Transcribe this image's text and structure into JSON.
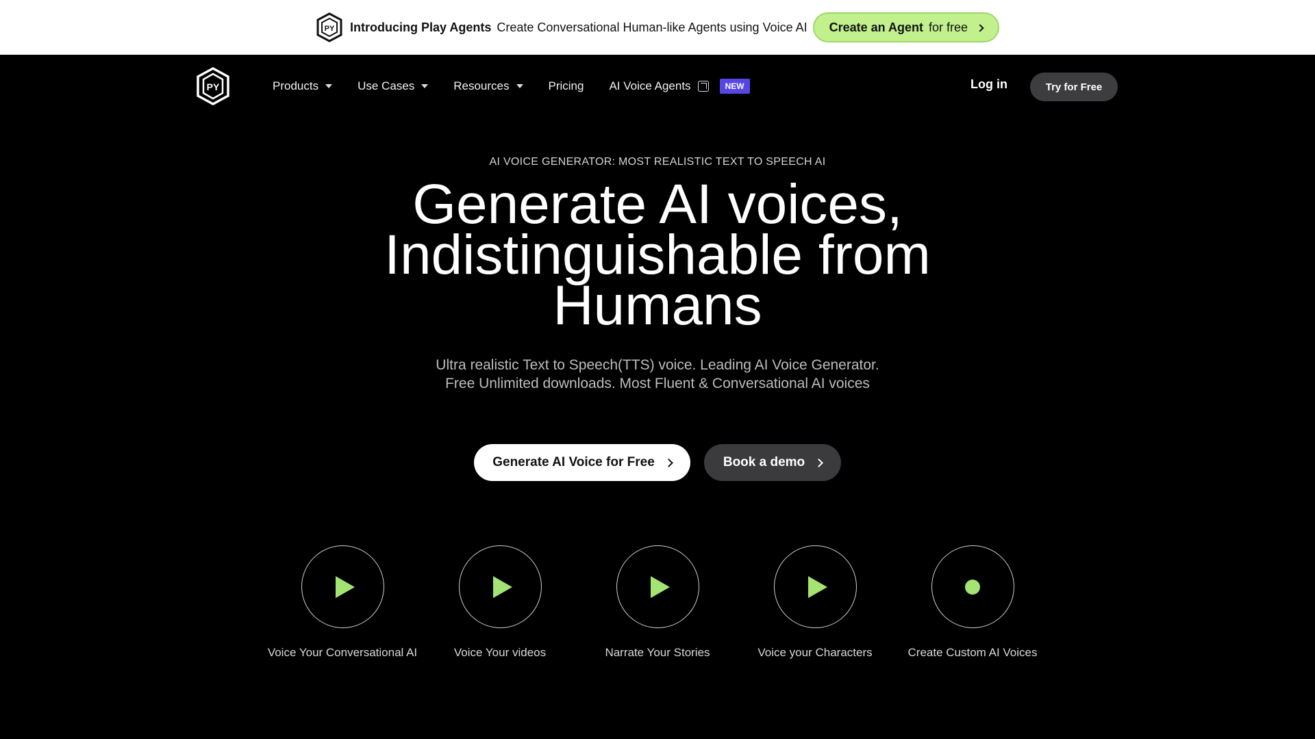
{
  "announcement": {
    "title": "Introducing Play Agents",
    "description": "Create Conversational Human-like Agents using Voice AI",
    "cta_bold": "Create an Agent",
    "cta_rest": "for free",
    "cta_bg": "#c2f08d"
  },
  "nav": {
    "items": [
      {
        "label": "Products",
        "dropdown": true
      },
      {
        "label": "Use Cases",
        "dropdown": true
      },
      {
        "label": "Resources",
        "dropdown": true
      },
      {
        "label": "Pricing",
        "dropdown": false
      },
      {
        "label": "AI Voice Agents",
        "external": true,
        "badge": "NEW"
      }
    ],
    "login": "Log in",
    "try": "Try for Free",
    "badge_color": "#5646e6"
  },
  "hero": {
    "eyebrow": "AI VOICE GENERATOR: MOST REALISTIC TEXT TO SPEECH AI",
    "headline_line1": "Generate AI voices,",
    "headline_line2": "Indistinguishable from",
    "headline_line3": "Humans",
    "sub_line1": "Ultra realistic Text to Speech(TTS) voice. Leading AI Voice Generator.",
    "sub_line2": "Free Unlimited downloads. Most Fluent & Conversational AI voices",
    "primary_cta": "Generate AI Voice for Free",
    "secondary_cta": "Book a demo"
  },
  "voice_cards": [
    {
      "label": "Voice Your Conversational AI",
      "icon": "play-icon"
    },
    {
      "label": "Voice Your videos",
      "icon": "play-icon"
    },
    {
      "label": "Narrate Your Stories",
      "icon": "play-icon"
    },
    {
      "label": "Voice your Characters",
      "icon": "play-icon"
    },
    {
      "label": "Create Custom AI Voices",
      "icon": "record-dot-icon"
    }
  ],
  "accent_color": "#a4e473"
}
